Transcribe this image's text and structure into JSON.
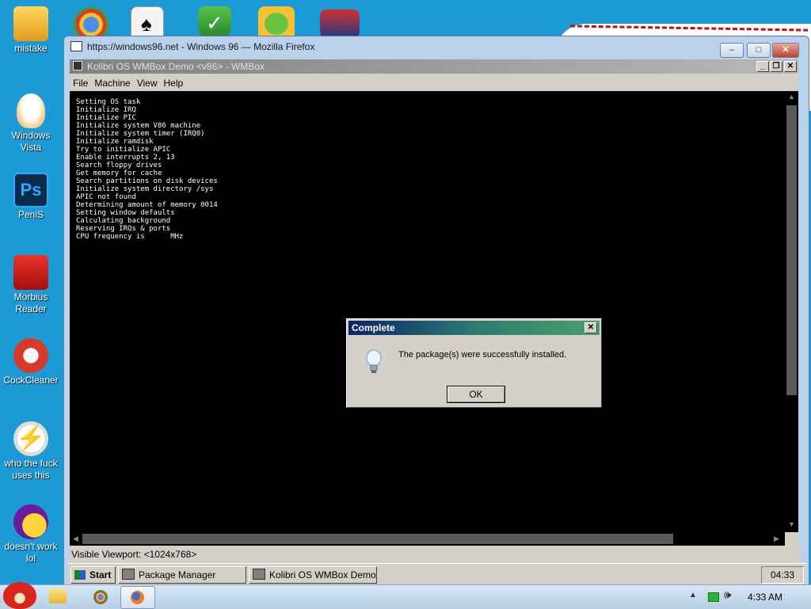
{
  "desktop": {
    "icons": [
      {
        "label": "mistake",
        "icon": "computer-folder-icon"
      },
      {
        "label": "Windows Vista",
        "icon": "egg-icon"
      },
      {
        "label": "PeniS",
        "icon": "photoshop-icon"
      },
      {
        "label": "Morbius Reader",
        "icon": "pdf-reader-icon"
      },
      {
        "label": "CockCleaner",
        "icon": "ccleaner-icon"
      },
      {
        "label": "who the fuck uses this",
        "icon": "lightning-icon"
      },
      {
        "label": "doesn't work lol",
        "icon": "yahoo-messenger-icon"
      }
    ],
    "top_icons": [
      "chrome-icon",
      "solitaire-icon",
      "shield-icon",
      "angry-birds-pig-icon",
      "winamp-icon"
    ]
  },
  "firefox": {
    "title": "https://windows96.net - Windows 96 — Mozilla Firefox",
    "minimize": "–",
    "maximize": "□",
    "close": "✕"
  },
  "wmbox": {
    "title": "Kolibri OS WMBox Demo <v86> - WMBox",
    "menu": [
      "File",
      "Machine",
      "View",
      "Help"
    ],
    "console_lines": [
      "Setting OS task",
      "Initialize IRQ",
      "Initialize PIC",
      "Initialize system V86 machine",
      "Initialize system timer (IRQ0)",
      "Initialize ramdisk",
      "Try to initialize APIC",
      "Enable interrupts 2, 13",
      "Search floppy drives",
      "Get memory for cache",
      "Search partitions on disk devices",
      "Initialize system directory /sys",
      "APIC not found",
      "Determining amount of memory 0014",
      "Setting window defaults",
      "Calculating background",
      "Reserving IRQs & ports",
      "CPU frequency is      MHz"
    ],
    "status": "Visible Viewport: <1024x768>"
  },
  "dialog": {
    "title": "Complete",
    "message": "The package(s) were successfully installed.",
    "ok_label": "OK",
    "close": "✕",
    "icon": "lightbulb-icon"
  },
  "win96_taskbar": {
    "start_label": "Start",
    "tasks": [
      "Package Manager",
      "Kolibri OS WMBox Demo <..."
    ],
    "clock": "04:33"
  },
  "win7_taskbar": {
    "clock": "4:33 AM",
    "pinned": [
      "angry-birds-start-icon",
      "explorer-folder-icon",
      "chrome-icon",
      "firefox-icon"
    ],
    "tray": [
      "tray-up-arrow-icon",
      "battery-icon",
      "volume-icon"
    ]
  }
}
